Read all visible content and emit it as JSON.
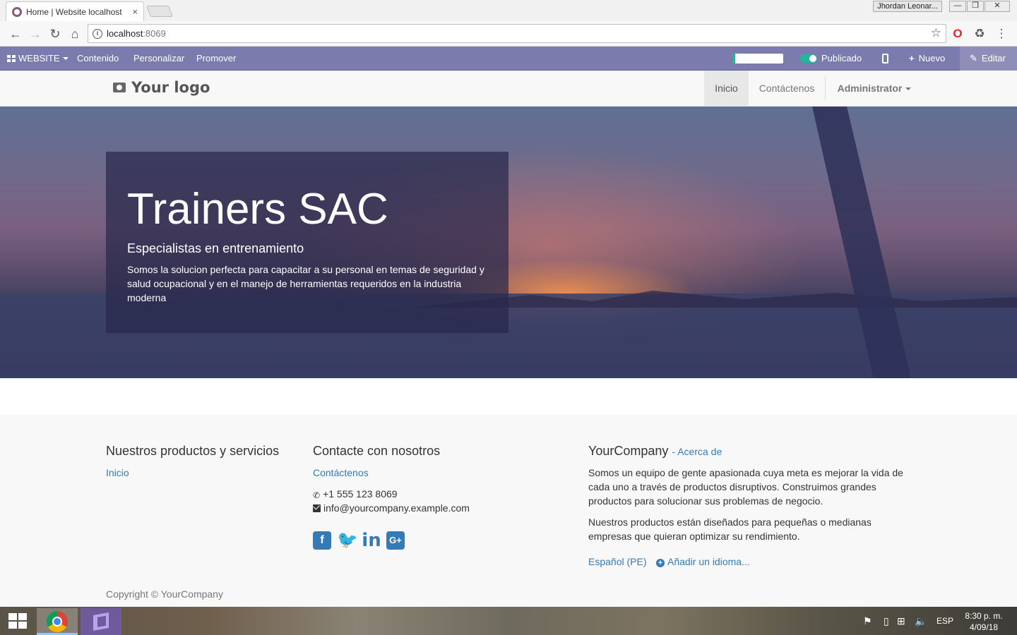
{
  "browser": {
    "tab_title": "Home | Website localhost",
    "tab_close": "×",
    "user_badge": "Jhordan Leonar...",
    "url_host": "localhost",
    "url_port": ":8069",
    "window_controls": [
      "—",
      "❐",
      "✕"
    ]
  },
  "odoo_bar": {
    "website_menu": "WEBSITE",
    "menu_items": [
      "Contenido",
      "Personalizar",
      "Promover"
    ],
    "published_label": "Publicado",
    "new_label": "Nuevo",
    "edit_label": "Editar",
    "colors": {
      "bar": "#7c7bad",
      "toggle": "#21b799"
    }
  },
  "site_header": {
    "logo_text": "Your logo",
    "nav": [
      "Inicio",
      "Contáctenos"
    ],
    "active_nav": "Inicio",
    "user_menu": "Administrator"
  },
  "hero": {
    "title": "Trainers SAC",
    "subtitle": "Especialistas en entrenamiento",
    "text": "Somos la solucion perfecta para capacitar a su personal en temas de seguridad y salud ocupacional y en el manejo de herramientas requeridos en la industria moderna"
  },
  "footer": {
    "products_heading": "Nuestros productos y servicios",
    "products_link": "Inicio",
    "contact_heading": "Contacte con nosotros",
    "contact_link": "Contáctenos",
    "phone": "+1 555 123 8069",
    "email": "info@yourcompany.example.com",
    "social_icons": [
      "facebook-icon",
      "twitter-icon",
      "linkedin-icon",
      "google-plus-icon"
    ],
    "company_heading": "YourCompany",
    "about_link": "- Acerca de",
    "about_p1": "Somos un equipo de gente apasionada cuya meta es mejorar la vida de cada uno a través de productos disruptivos. Construimos grandes productos para solucionar sus problemas de negocio.",
    "about_p2": "Nuestros productos están diseñados para pequeñas o medianas empresas que quieran optimizar su rendimiento.",
    "language": "Español (PE)",
    "add_language": "Añadir un idioma...",
    "copyright": "Copyright © YourCompany",
    "link_color": "#337ab7"
  },
  "taskbar": {
    "language": "ESP",
    "time": "8:30 p. m.",
    "date": "4/09/18"
  }
}
